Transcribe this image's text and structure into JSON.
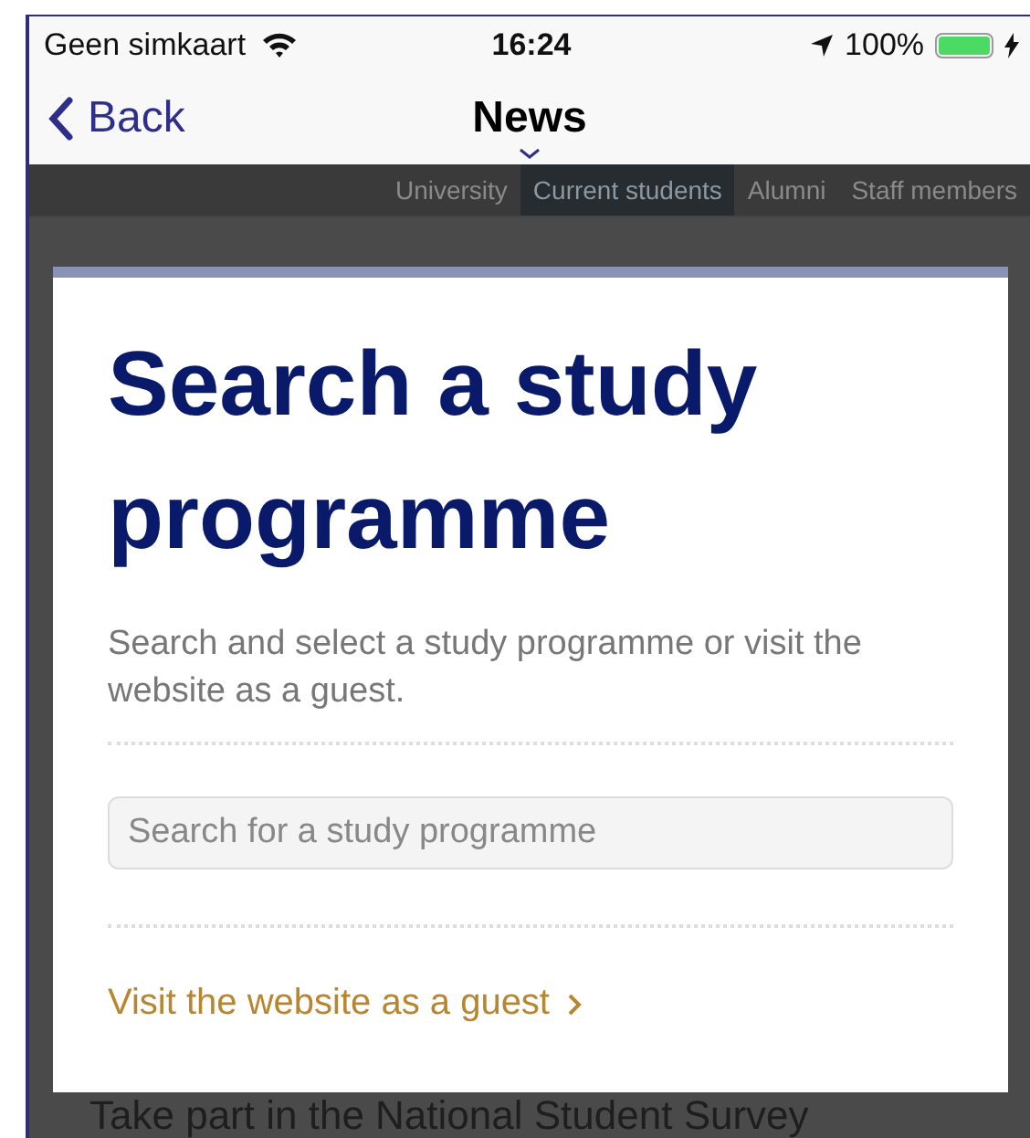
{
  "status_bar": {
    "carrier": "Geen simkaart",
    "time": "16:24",
    "battery": "100%",
    "charging": true
  },
  "nav": {
    "back": "Back",
    "title": "News"
  },
  "tabs": [
    {
      "label": "University",
      "selected": false
    },
    {
      "label": "Current students",
      "selected": true
    },
    {
      "label": "Alumni",
      "selected": false
    },
    {
      "label": "Staff members",
      "selected": false
    }
  ],
  "background_text": "Take part in the National Student Survey",
  "modal": {
    "title": "Search a study programme",
    "description": "Search and select a study programme or visit the website as a guest.",
    "search": {
      "placeholder": "Search for a study programme"
    },
    "link": "Visit the website as a guest"
  }
}
